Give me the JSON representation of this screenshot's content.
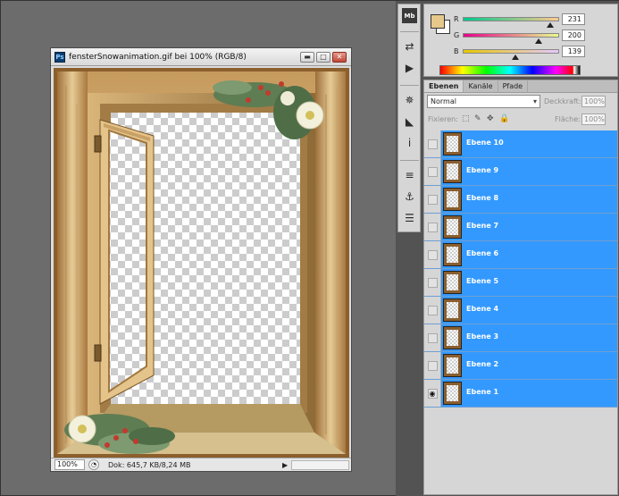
{
  "document": {
    "badge": "Ps",
    "title": "fensterSnowanimation.gif bei 100% (RGB/8)",
    "status": {
      "zoom": "100%",
      "info": "Dok: 645,7 KB/8,24 MB",
      "arrow": "▶"
    },
    "window_buttons": {
      "minimize": "▬",
      "maximize": "□",
      "close": "✕"
    }
  },
  "tools": [
    {
      "name": "mini-bridge-icon",
      "glyph": "Mb"
    },
    {
      "name": "history-icon",
      "glyph": "⇄"
    },
    {
      "name": "actions-icon",
      "glyph": "▶"
    },
    {
      "name": "navigator-icon",
      "glyph": "✵"
    },
    {
      "name": "histogram-icon",
      "glyph": "◣"
    },
    {
      "name": "info-icon",
      "glyph": "i"
    },
    {
      "name": "brush-presets-icon",
      "glyph": "≡"
    },
    {
      "name": "clone-source-icon",
      "glyph": "⚓"
    },
    {
      "name": "tool-presets-icon",
      "glyph": "☰"
    }
  ],
  "color": {
    "foreground": "#e7c88b",
    "background": "#ffffff",
    "channels": [
      {
        "label": "R",
        "value": "231",
        "level": 0.906
      },
      {
        "label": "G",
        "value": "200",
        "level": 0.784
      },
      {
        "label": "B",
        "value": "139",
        "level": 0.545
      }
    ]
  },
  "layers_panel": {
    "tabs": [
      "Ebenen",
      "Kanäle",
      "Pfade"
    ],
    "blend_mode": "Normal",
    "opacity_label": "Deckkraft:",
    "opacity_value": "100%",
    "lock_label": "Fixieren:",
    "fill_label": "Fläche:",
    "fill_value": "100%",
    "eye_glyph": "◉",
    "layers": [
      {
        "name": "Ebene 10",
        "visible": false
      },
      {
        "name": "Ebene 9",
        "visible": false
      },
      {
        "name": "Ebene 8",
        "visible": false
      },
      {
        "name": "Ebene 7",
        "visible": false
      },
      {
        "name": "Ebene 6",
        "visible": false
      },
      {
        "name": "Ebene 5",
        "visible": false
      },
      {
        "name": "Ebene 4",
        "visible": false
      },
      {
        "name": "Ebene 3",
        "visible": false
      },
      {
        "name": "Ebene 2",
        "visible": false
      },
      {
        "name": "Ebene 1",
        "visible": true
      }
    ]
  }
}
